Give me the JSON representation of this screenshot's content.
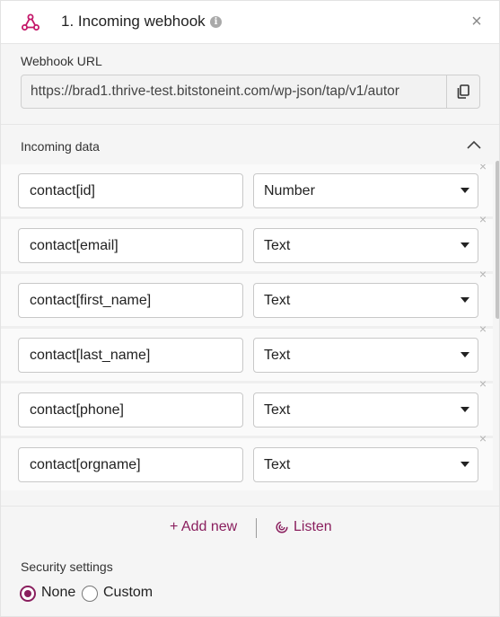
{
  "header": {
    "title": "1. Incoming webhook",
    "info_glyph": "i",
    "close_glyph": "×",
    "logo_icon": "webhook-icon",
    "accent_color": "#c4186a"
  },
  "webhook_url": {
    "label": "Webhook URL",
    "value": "https://brad1.thrive-test.bitstoneint.com/wp-json/tap/v1/autor",
    "copy_icon": "copy-icon"
  },
  "incoming_data": {
    "label": "Incoming data",
    "rows": [
      {
        "field": "contact[id]",
        "type": "Number"
      },
      {
        "field": "contact[email]",
        "type": "Text"
      },
      {
        "field": "contact[first_name]",
        "type": "Text"
      },
      {
        "field": "contact[last_name]",
        "type": "Text"
      },
      {
        "field": "contact[phone]",
        "type": "Text"
      },
      {
        "field": "contact[orgname]",
        "type": "Text"
      }
    ],
    "remove_glyph": "×",
    "add_new_label": "+ Add new",
    "listen_label": "Listen"
  },
  "security": {
    "label": "Security settings",
    "options": [
      {
        "label": "None",
        "selected": true
      },
      {
        "label": "Custom",
        "selected": false
      }
    ]
  },
  "colors": {
    "brand": "#8a1f5e",
    "background": "#f5f5f5"
  }
}
